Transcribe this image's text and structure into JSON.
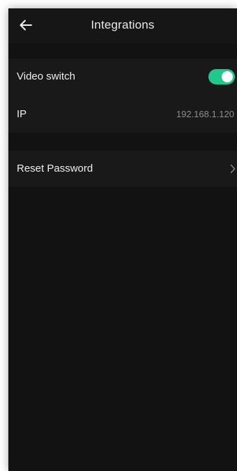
{
  "header": {
    "title": "Integrations",
    "back_icon": "arrow-left-icon"
  },
  "settings": {
    "video_switch": {
      "label": "Video switch",
      "enabled": true,
      "accent_color": "#1fc98c"
    },
    "ip": {
      "label": "IP",
      "value": "192.168.1.120"
    },
    "reset_password": {
      "label": "Reset Password",
      "icon": "chevron-right-icon"
    }
  },
  "colors": {
    "background": "#121212",
    "row_background": "#191919",
    "text": "#eeeeee",
    "secondary_text": "#8f8f8f"
  }
}
